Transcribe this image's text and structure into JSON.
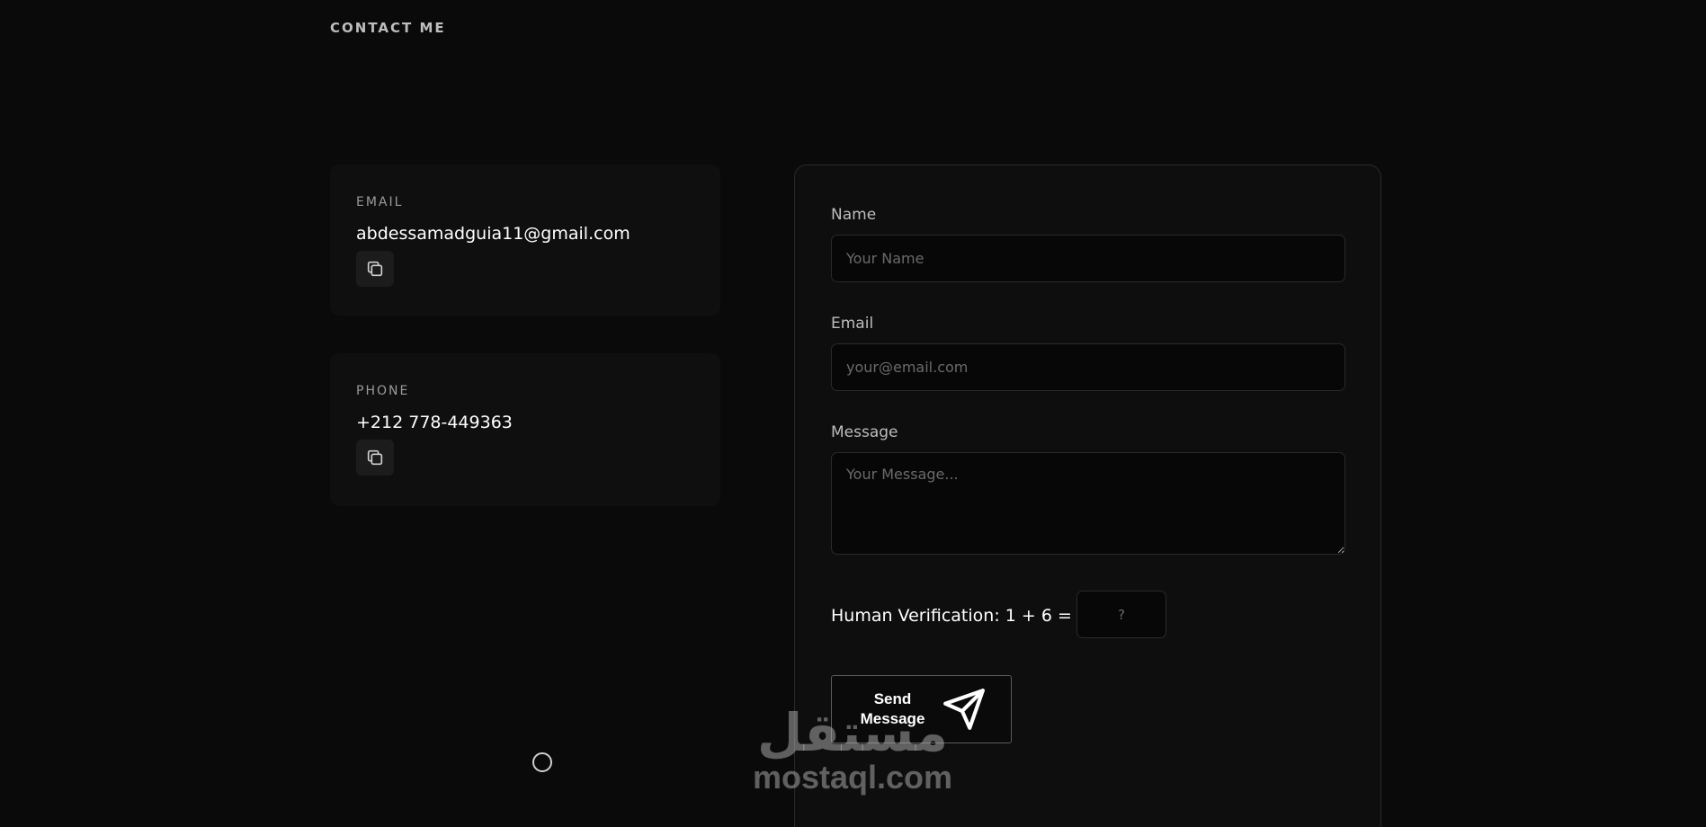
{
  "header": {
    "title": "CONTACT ME"
  },
  "contact_cards": {
    "email": {
      "label": "EMAIL",
      "value": "abdessamadguia11@gmail.com"
    },
    "phone": {
      "label": "PHONE",
      "value": "+212 778-449363"
    }
  },
  "form": {
    "name": {
      "label": "Name",
      "placeholder": "Your Name",
      "value": ""
    },
    "email": {
      "label": "Email",
      "placeholder": "your@email.com",
      "value": ""
    },
    "message": {
      "label": "Message",
      "placeholder": "Your Message...",
      "value": ""
    },
    "verification": {
      "label": "Human Verification: 1 + 6 = ?",
      "placeholder": "?",
      "value": ""
    },
    "submit": {
      "label": "Send Message"
    }
  },
  "watermark": {
    "arabic": "مستقل",
    "latin": "mostaql.com"
  },
  "icons": {
    "copy": "copy-icon",
    "send": "paper-plane-icon",
    "loading": "loading-circle-icon"
  },
  "colors": {
    "background": "#0a0a0a",
    "card": "#0f0f0f",
    "border": "#2a2a2a",
    "text": "#ffffff",
    "muted": "#9a9a9a"
  }
}
